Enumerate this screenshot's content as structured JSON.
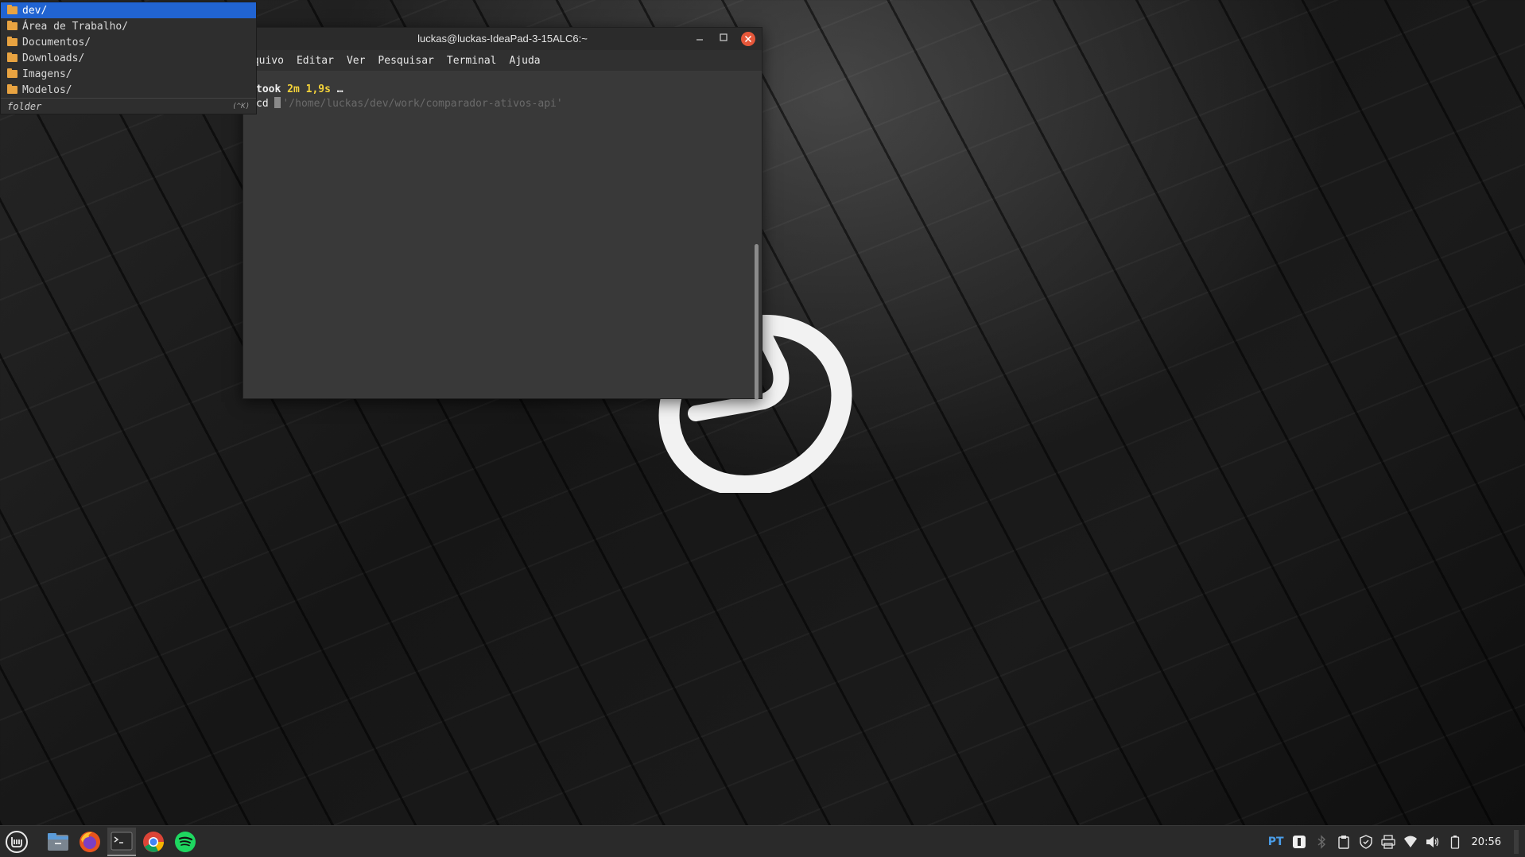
{
  "terminal": {
    "title": "luckas@luckas-IdeaPad-3-15ALC6:~",
    "menu": [
      "rquivo",
      "Editar",
      "Ver",
      "Pesquisar",
      "Terminal",
      "Ajuda"
    ],
    "line1": {
      "took": "took",
      "duration": "2m 1,9s",
      "ellipsis": "…"
    },
    "line2": {
      "command": "cd ",
      "suggestion": "'/home/luckas/dev/work/comparador-ativos-api'"
    }
  },
  "completion": {
    "items": [
      "dev/",
      "Área de Trabalho/",
      "Documentos/",
      "Downloads/",
      "Imagens/",
      "Modelos/"
    ],
    "selected_index": 0,
    "footer_label": "folder",
    "footer_hint": "(^K)"
  },
  "taskbar": {
    "apps": [
      "mint-menu-icon",
      "files-icon",
      "firefox-icon",
      "terminal-icon",
      "chrome-icon",
      "spotify-icon"
    ],
    "keyboard_layout": "PT",
    "clock": "20:56"
  },
  "colors": {
    "accent": "#2164d2",
    "folder": "#e8a341",
    "close": "#e6573a",
    "highlight": "#f4d33a",
    "keyboard": "#4a9de8"
  }
}
